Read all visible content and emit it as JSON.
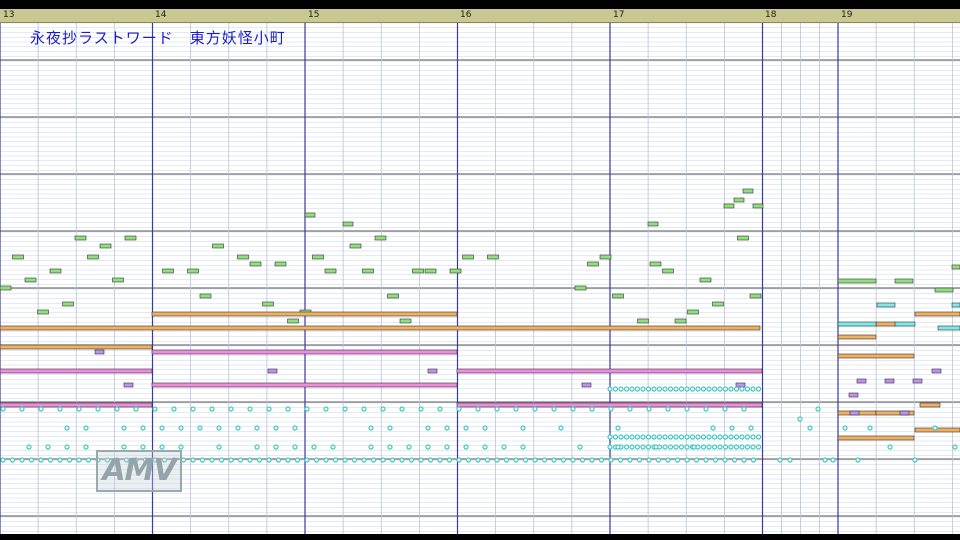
{
  "window": {
    "song_title": "永夜抄ラストワード　東方妖怪小町",
    "watermark": "AMV"
  },
  "ruler": {
    "measures": [
      "13",
      "14",
      "15",
      "16",
      "17",
      "18",
      "19"
    ]
  },
  "colors": {
    "background": "#ffffff",
    "row_line": "#c8d6ea",
    "octave_line": "#555555",
    "measure_line": "#3a3aa0",
    "beat_line": "#b8c2d8",
    "lead": "#8fe07a",
    "bass": "#f0b060",
    "pad": "#f08ce0",
    "arp": "#c090f0",
    "sub": "#80e8e8",
    "drum": "#40c8c0"
  }
}
